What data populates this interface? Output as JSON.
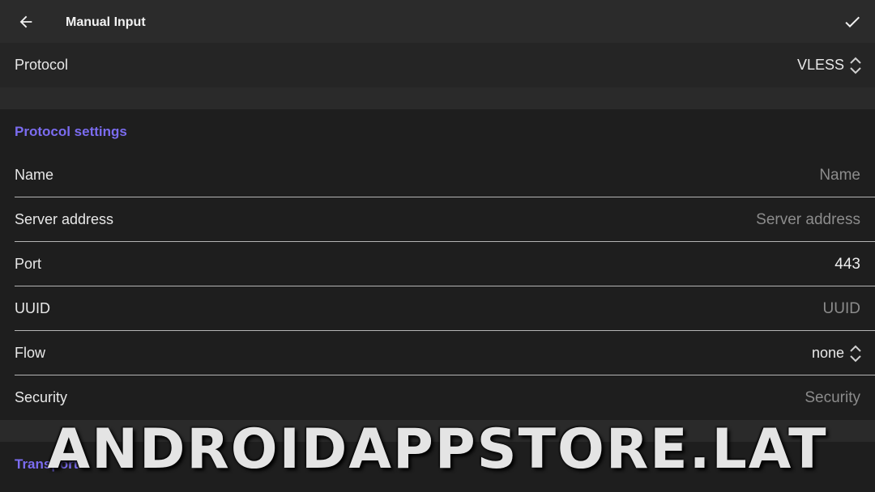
{
  "appbar": {
    "title": "Manual Input",
    "back_icon": "arrow-left-icon",
    "confirm_icon": "check-icon"
  },
  "protocol": {
    "label": "Protocol",
    "selected": "VLESS"
  },
  "protocol_settings": {
    "title": "Protocol settings",
    "fields": [
      {
        "label": "Name",
        "placeholder": "Name",
        "value": ""
      },
      {
        "label": "Server address",
        "placeholder": "Server address",
        "value": ""
      },
      {
        "label": "Port",
        "placeholder": "",
        "value": "443"
      },
      {
        "label": "UUID",
        "placeholder": "UUID",
        "value": ""
      },
      {
        "label": "Flow",
        "selected": "none"
      },
      {
        "label": "Security",
        "placeholder": "Security",
        "value": ""
      }
    ]
  },
  "transport": {
    "title": "Transport"
  },
  "watermark": "ANDROIDAPPSTORE.LAT",
  "colors": {
    "accent": "#7b6cf0",
    "background": "#1e1e1e",
    "appbar": "#2b2b2b"
  }
}
